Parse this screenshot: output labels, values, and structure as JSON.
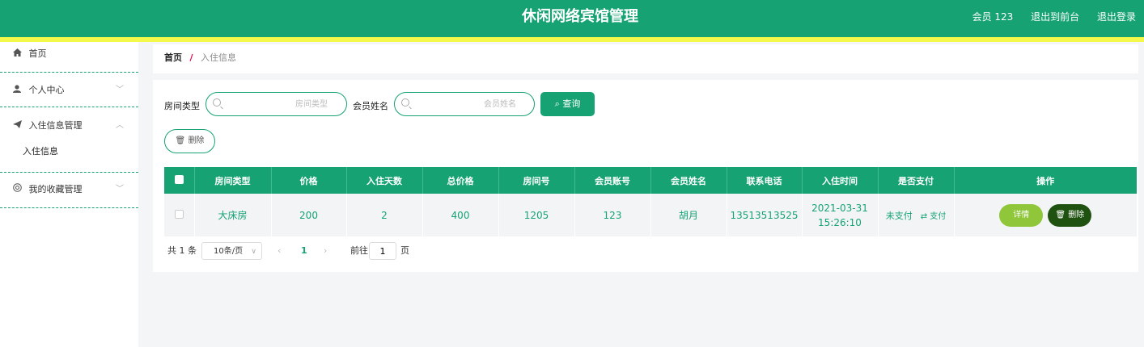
{
  "header": {
    "title": "休闲网络宾馆管理",
    "user": "会员 123",
    "front": "退出到前台",
    "logout": "退出登录"
  },
  "sidebar": {
    "items": [
      {
        "label": "首页",
        "icon": "home-icon"
      },
      {
        "label": "个人中心",
        "icon": "user-icon"
      },
      {
        "label": "入住信息管理",
        "icon": "send-icon"
      },
      {
        "label": "入住信息",
        "icon": ""
      },
      {
        "label": "我的收藏管理",
        "icon": "collect-icon"
      }
    ]
  },
  "breadcrumb": {
    "home": "首页",
    "sep": "/",
    "current": "入住信息"
  },
  "search": {
    "room_type_label": "房间类型",
    "room_type_placeholder": "房间类型",
    "member_name_label": "会员姓名",
    "member_name_placeholder": "会员姓名",
    "query_button": "查询",
    "delete_button": "删除"
  },
  "table": {
    "columns": [
      "房间类型",
      "价格",
      "入住天数",
      "总价格",
      "房间号",
      "会员账号",
      "会员姓名",
      "联系电话",
      "入住时间",
      "是否支付",
      "操作"
    ],
    "rows": [
      {
        "room_type": "大床房",
        "price": "200",
        "days": "2",
        "total": "400",
        "room_no": "1205",
        "account": "123",
        "name": "胡月",
        "phone": "13513513525",
        "checkin": "2021-03-31 15:26:10",
        "paid": "未支付",
        "pay_action": "支付",
        "detail_button": "详情",
        "delete_button": "删除"
      }
    ]
  },
  "pager": {
    "total": "共 1 条",
    "page_size": "10条/页",
    "prev": "‹",
    "page": "1",
    "next": "›",
    "goto": "前往",
    "goto_value": "1",
    "page_unit": "页"
  },
  "colors": {
    "primary": "#16a273",
    "stripe": "#f3f84a",
    "detail": "#8fc63a",
    "delete": "#1f5210"
  }
}
